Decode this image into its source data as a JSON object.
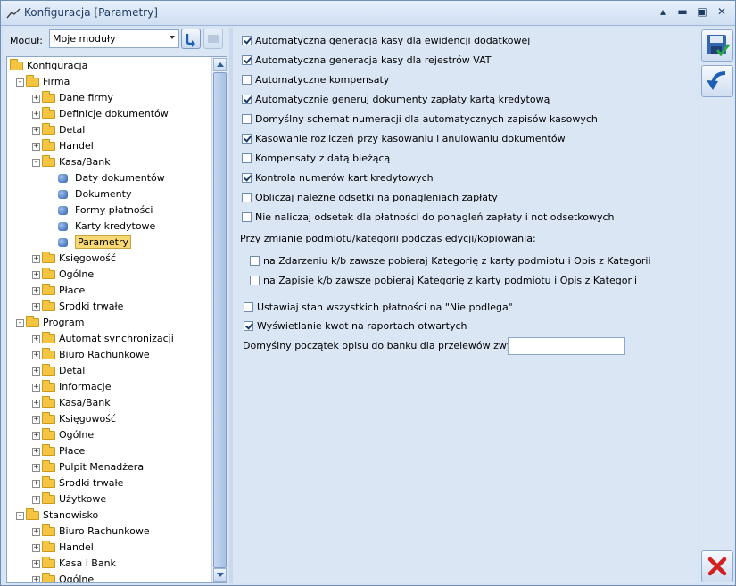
{
  "window": {
    "title": "Konfiguracja [Parametry]"
  },
  "module": {
    "label": "Moduł:",
    "value": "Moje moduły"
  },
  "tree": [
    {
      "label": "Konfiguracja",
      "level": 0,
      "icon": "folder-icon",
      "expander": ""
    },
    {
      "label": "Firma",
      "level": 1,
      "icon": "folder-icon",
      "expander": "-"
    },
    {
      "label": "Dane firmy",
      "level": 2,
      "icon": "folder-icon",
      "expander": "+"
    },
    {
      "label": "Definicje dokumentów",
      "level": 2,
      "icon": "folder-icon",
      "expander": "+"
    },
    {
      "label": "Detal",
      "level": 2,
      "icon": "folder-icon",
      "expander": "+"
    },
    {
      "label": "Handel",
      "level": 2,
      "icon": "folder-icon",
      "expander": "+"
    },
    {
      "label": "Kasa/Bank",
      "level": 2,
      "icon": "folder-icon",
      "expander": "-"
    },
    {
      "label": "Daty dokumentów",
      "level": 3,
      "icon": "leaf-icon",
      "expander": ""
    },
    {
      "label": "Dokumenty",
      "level": 3,
      "icon": "leaf-icon",
      "expander": ""
    },
    {
      "label": "Formy płatności",
      "level": 3,
      "icon": "leaf-icon",
      "expander": ""
    },
    {
      "label": "Karty kredytowe",
      "level": 3,
      "icon": "leaf-icon",
      "expander": ""
    },
    {
      "label": "Parametry",
      "level": 3,
      "icon": "leaf-icon",
      "expander": "",
      "selected": true
    },
    {
      "label": "Księgowość",
      "level": 2,
      "icon": "folder-icon",
      "expander": "+"
    },
    {
      "label": "Ogólne",
      "level": 2,
      "icon": "folder-icon",
      "expander": "+"
    },
    {
      "label": "Płace",
      "level": 2,
      "icon": "folder-icon",
      "expander": "+"
    },
    {
      "label": "Środki trwałe",
      "level": 2,
      "icon": "folder-icon",
      "expander": "+"
    },
    {
      "label": "Program",
      "level": 1,
      "icon": "folder-icon",
      "expander": "-"
    },
    {
      "label": "Automat synchronizacji",
      "level": 2,
      "icon": "folder-icon",
      "expander": "+"
    },
    {
      "label": "Biuro Rachunkowe",
      "level": 2,
      "icon": "folder-icon",
      "expander": "+"
    },
    {
      "label": "Detal",
      "level": 2,
      "icon": "folder-icon",
      "expander": "+"
    },
    {
      "label": "Informacje",
      "level": 2,
      "icon": "folder-icon",
      "expander": "+"
    },
    {
      "label": "Kasa/Bank",
      "level": 2,
      "icon": "folder-icon",
      "expander": "+"
    },
    {
      "label": "Księgowość",
      "level": 2,
      "icon": "folder-icon",
      "expander": "+"
    },
    {
      "label": "Ogólne",
      "level": 2,
      "icon": "folder-icon",
      "expander": "+"
    },
    {
      "label": "Płace",
      "level": 2,
      "icon": "folder-icon",
      "expander": "+"
    },
    {
      "label": "Pulpit Menadżera",
      "level": 2,
      "icon": "folder-icon",
      "expander": "+"
    },
    {
      "label": "Środki trwałe",
      "level": 2,
      "icon": "folder-icon",
      "expander": "+"
    },
    {
      "label": "Użytkowe",
      "level": 2,
      "icon": "folder-icon",
      "expander": "+"
    },
    {
      "label": "Stanowisko",
      "level": 1,
      "icon": "folder-icon",
      "expander": "-"
    },
    {
      "label": "Biuro Rachunkowe",
      "level": 2,
      "icon": "folder-icon",
      "expander": "+"
    },
    {
      "label": "Handel",
      "level": 2,
      "icon": "folder-icon",
      "expander": "+"
    },
    {
      "label": "Kasa i Bank",
      "level": 2,
      "icon": "folder-icon",
      "expander": "+"
    },
    {
      "label": "Ogólne",
      "level": 2,
      "icon": "folder-icon",
      "expander": "+"
    }
  ],
  "options": [
    {
      "label": "Automatyczna generacja kasy dla ewidencji dodatkowej",
      "checked": true
    },
    {
      "label": "Automatyczna generacja kasy dla rejestrów VAT",
      "checked": true
    },
    {
      "label": "Automatyczne kompensaty",
      "checked": false
    },
    {
      "label": "Automatycznie generuj dokumenty zapłaty kartą kredytową",
      "checked": true
    },
    {
      "label": "Domyślny schemat numeracji dla automatycznych zapisów kasowych",
      "checked": false
    },
    {
      "label": "Kasowanie rozliczeń przy kasowaniu i anulowaniu dokumentów",
      "checked": true
    },
    {
      "label": "Kompensaty z datą bieżącą",
      "checked": false
    },
    {
      "label": "Kontrola numerów kart kredytowych",
      "checked": true
    },
    {
      "label": "Obliczaj należne odsetki na ponagleniach zapłaty",
      "checked": false
    },
    {
      "label": "Nie naliczaj odsetek dla płatności do ponagleń zapłaty i not odsetkowych",
      "checked": false
    }
  ],
  "change_section": {
    "label": "Przy zmianie podmiotu/kategorii podczas edycji/kopiowania:",
    "options": [
      {
        "label": "na Zdarzeniu k/b zawsze pobieraj Kategorię z karty podmiotu i Opis z Kategorii",
        "checked": false
      },
      {
        "label": "na Zapisie k/b zawsze pobieraj Kategorię z karty podmiotu i Opis z Kategorii",
        "checked": false
      }
    ]
  },
  "extra_options": [
    {
      "label": "Ustawiaj stan wszystkich płatności na \"Nie podlega\"",
      "checked": false
    },
    {
      "label": "Wyświetlanie kwot na raportach otwartych",
      "checked": true
    }
  ],
  "bank_desc": {
    "label": "Domyślny początek opisu do banku dla przelewów zwykłych:",
    "value": ""
  }
}
